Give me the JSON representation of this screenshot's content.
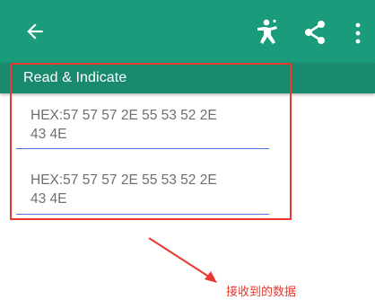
{
  "section": {
    "title": "Read & Indicate"
  },
  "entries": [
    {
      "line1": "HEX:57 57 57 2E 55 53 52 2E",
      "line2": "43 4E"
    },
    {
      "line1": "HEX:57 57 57 2E 55 53 52 2E",
      "line2": "43 4E"
    }
  ],
  "annotation": {
    "text": "接收到的数据"
  },
  "icons": {
    "back": "arrow-back-icon",
    "person": "person-icon",
    "share": "share-icon",
    "more": "more-vert-icon"
  },
  "colors": {
    "appbar": "#1a9b7c",
    "section": "#1a8a6e",
    "underline": "#4d6fd9",
    "annotation": "#e7392f"
  }
}
